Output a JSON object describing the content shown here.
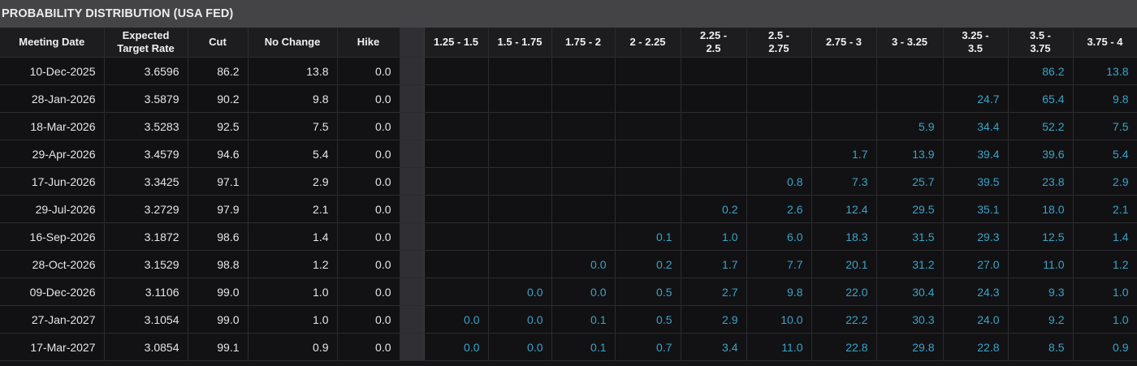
{
  "title": "PROBABILITY DISTRIBUTION (USA FED)",
  "headers": {
    "meeting_date": "Meeting Date",
    "expected_target_rate_line1": "Expected",
    "expected_target_rate_line2": "Target Rate",
    "cut": "Cut",
    "no_change": "No Change",
    "hike": "Hike",
    "ranges": [
      {
        "line1": "1.25 - 1.5",
        "line2": ""
      },
      {
        "line1": "1.5 - 1.75",
        "line2": ""
      },
      {
        "line1": "1.75 - 2",
        "line2": ""
      },
      {
        "line1": "2 - 2.25",
        "line2": ""
      },
      {
        "line1": "2.25 -",
        "line2": "2.5"
      },
      {
        "line1": "2.5 -",
        "line2": "2.75"
      },
      {
        "line1": "2.75 - 3",
        "line2": ""
      },
      {
        "line1": "3 - 3.25",
        "line2": ""
      },
      {
        "line1": "3.25 -",
        "line2": "3.5"
      },
      {
        "line1": "3.5 -",
        "line2": "3.75"
      },
      {
        "line1": "3.75 - 4",
        "line2": ""
      }
    ]
  },
  "rows": [
    {
      "date": "10-Dec-2025",
      "rate": "3.6596",
      "cut": "86.2",
      "no_change": "13.8",
      "hike": "0.0",
      "probs": [
        "",
        "",
        "",
        "",
        "",
        "",
        "",
        "",
        "",
        "86.2",
        "13.8"
      ]
    },
    {
      "date": "28-Jan-2026",
      "rate": "3.5879",
      "cut": "90.2",
      "no_change": "9.8",
      "hike": "0.0",
      "probs": [
        "",
        "",
        "",
        "",
        "",
        "",
        "",
        "",
        "24.7",
        "65.4",
        "9.8"
      ]
    },
    {
      "date": "18-Mar-2026",
      "rate": "3.5283",
      "cut": "92.5",
      "no_change": "7.5",
      "hike": "0.0",
      "probs": [
        "",
        "",
        "",
        "",
        "",
        "",
        "",
        "5.9",
        "34.4",
        "52.2",
        "7.5"
      ]
    },
    {
      "date": "29-Apr-2026",
      "rate": "3.4579",
      "cut": "94.6",
      "no_change": "5.4",
      "hike": "0.0",
      "probs": [
        "",
        "",
        "",
        "",
        "",
        "",
        "1.7",
        "13.9",
        "39.4",
        "39.6",
        "5.4"
      ]
    },
    {
      "date": "17-Jun-2026",
      "rate": "3.3425",
      "cut": "97.1",
      "no_change": "2.9",
      "hike": "0.0",
      "probs": [
        "",
        "",
        "",
        "",
        "",
        "0.8",
        "7.3",
        "25.7",
        "39.5",
        "23.8",
        "2.9"
      ]
    },
    {
      "date": "29-Jul-2026",
      "rate": "3.2729",
      "cut": "97.9",
      "no_change": "2.1",
      "hike": "0.0",
      "probs": [
        "",
        "",
        "",
        "",
        "0.2",
        "2.6",
        "12.4",
        "29.5",
        "35.1",
        "18.0",
        "2.1"
      ]
    },
    {
      "date": "16-Sep-2026",
      "rate": "3.1872",
      "cut": "98.6",
      "no_change": "1.4",
      "hike": "0.0",
      "probs": [
        "",
        "",
        "",
        "0.1",
        "1.0",
        "6.0",
        "18.3",
        "31.5",
        "29.3",
        "12.5",
        "1.4"
      ]
    },
    {
      "date": "28-Oct-2026",
      "rate": "3.1529",
      "cut": "98.8",
      "no_change": "1.2",
      "hike": "0.0",
      "probs": [
        "",
        "",
        "0.0",
        "0.2",
        "1.7",
        "7.7",
        "20.1",
        "31.2",
        "27.0",
        "11.0",
        "1.2"
      ]
    },
    {
      "date": "09-Dec-2026",
      "rate": "3.1106",
      "cut": "99.0",
      "no_change": "1.0",
      "hike": "0.0",
      "probs": [
        "",
        "0.0",
        "0.0",
        "0.5",
        "2.7",
        "9.8",
        "22.0",
        "30.4",
        "24.3",
        "9.3",
        "1.0"
      ]
    },
    {
      "date": "27-Jan-2027",
      "rate": "3.1054",
      "cut": "99.0",
      "no_change": "1.0",
      "hike": "0.0",
      "probs": [
        "0.0",
        "0.0",
        "0.1",
        "0.5",
        "2.9",
        "10.0",
        "22.2",
        "30.3",
        "24.0",
        "9.2",
        "1.0"
      ]
    },
    {
      "date": "17-Mar-2027",
      "rate": "3.0854",
      "cut": "99.1",
      "no_change": "0.9",
      "hike": "0.0",
      "probs": [
        "0.0",
        "0.0",
        "0.1",
        "0.7",
        "3.4",
        "11.0",
        "22.8",
        "29.8",
        "22.8",
        "8.5",
        "0.9"
      ]
    }
  ],
  "colors": {
    "probability_value": "#3aa3c8",
    "header_bg": "#1d1d1f",
    "title_bg": "#444446"
  }
}
